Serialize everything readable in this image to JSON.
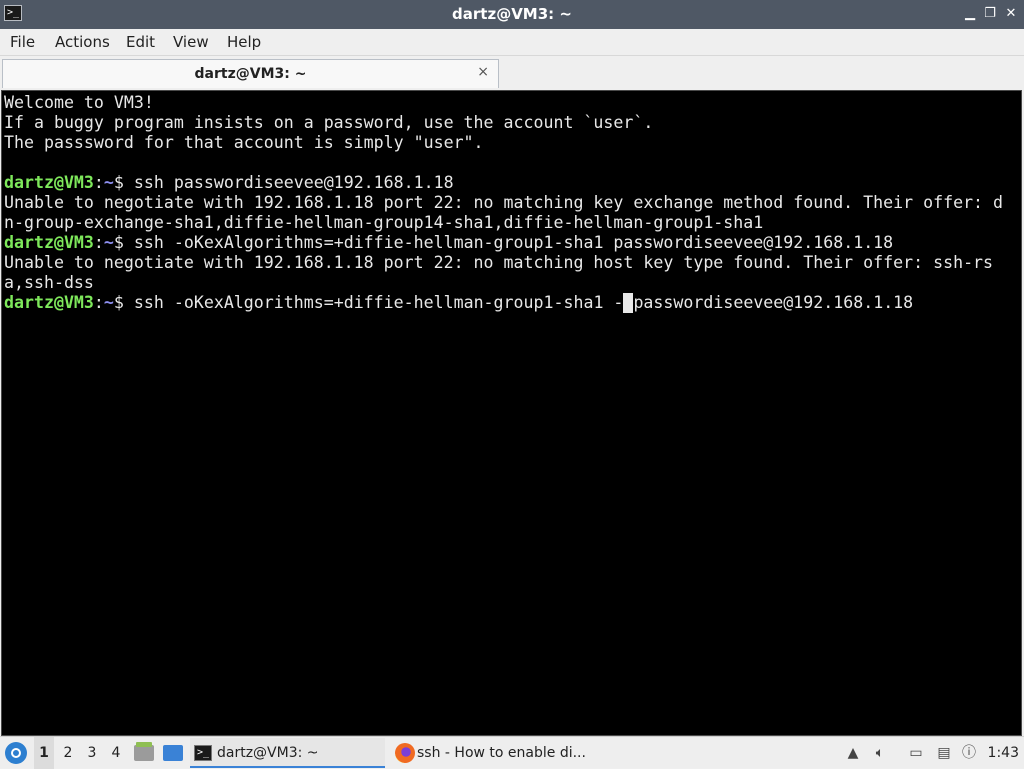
{
  "window": {
    "title": "dartz@VM3: ~"
  },
  "menubar": {
    "items": [
      "File",
      "Actions",
      "Edit",
      "View",
      "Help"
    ]
  },
  "tabs": [
    {
      "label": "dartz@VM3: ~",
      "close_glyph": "×"
    }
  ],
  "terminal": {
    "lines": [
      {
        "text": "Welcome to VM3!"
      },
      {
        "text": "If a buggy program insists on a password, use the account `user`."
      },
      {
        "text": "The passsword for that account is simply \"user\"."
      },
      {
        "text": ""
      },
      {
        "prompt_user": "dartz@VM3",
        "prompt_colon": ":",
        "prompt_path": "~",
        "text": "$ ssh passwordiseevee@192.168.1.18"
      },
      {
        "text": "Unable to negotiate with 192.168.1.18 port 22: no matching key exchange method found. Their offer: d"
      },
      {
        "text": "n-group-exchange-sha1,diffie-hellman-group14-sha1,diffie-hellman-group1-sha1"
      },
      {
        "prompt_user": "dartz@VM3",
        "prompt_colon": ":",
        "prompt_path": "~",
        "text": "$ ssh -oKexAlgorithms=+diffie-hellman-group1-sha1 passwordiseevee@192.168.1.18"
      },
      {
        "text": "Unable to negotiate with 192.168.1.18 port 22: no matching host key type found. Their offer: ssh-rs"
      },
      {
        "text": "a,ssh-dss"
      },
      {
        "prompt_user": "dartz@VM3",
        "prompt_colon": ":",
        "prompt_path": "~",
        "text": "$ ssh -oKexAlgorithms=+diffie-hellman-group1-sha1 -",
        "cursor_char": " ",
        "text_after": "passwordiseevee@192.168.1.18"
      }
    ]
  },
  "taskbar": {
    "workspaces": [
      "1",
      "2",
      "3",
      "4"
    ],
    "active_workspace": "1",
    "tasks": [
      {
        "label": "dartz@VM3: ~",
        "icon": "terminal-icon",
        "active": true
      },
      {
        "label": "ssh - How to enable di...",
        "icon": "firefox-icon",
        "active": false
      }
    ],
    "tray_icons": [
      "notification-icon",
      "volume-icon",
      "network-icon",
      "clipboard-icon",
      "update-icon"
    ],
    "clock": "1:43"
  },
  "colors": {
    "titlebar_bg": "#4f5865",
    "terminal_bg": "#000000",
    "terminal_fg": "#e8e8e8",
    "prompt_user": "#7ee85b",
    "prompt_path": "#8d8ff0",
    "accent": "#3a82d6"
  }
}
